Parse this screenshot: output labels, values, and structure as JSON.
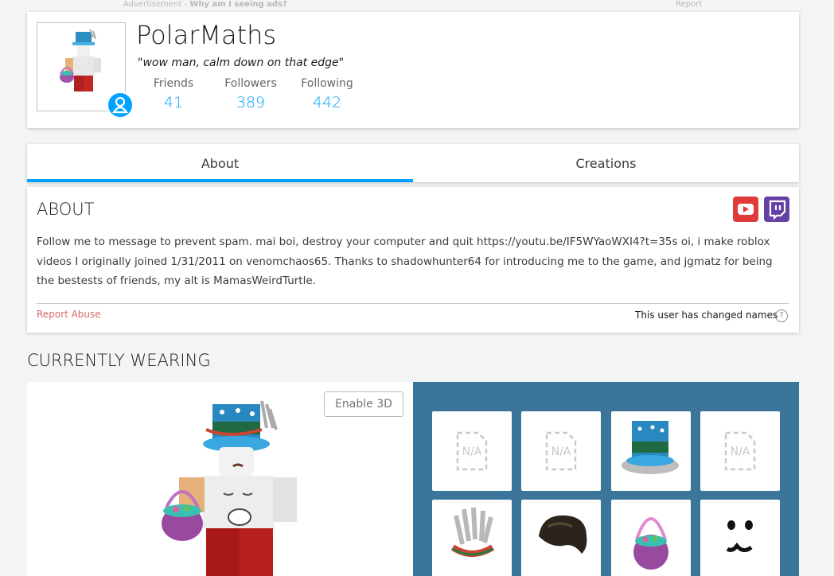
{
  "ads": {
    "label": "Advertisement - ",
    "why": "Why am I seeing ads?",
    "report": "Report"
  },
  "profile": {
    "username": "PolarMaths",
    "status": "\"wow man, calm down on that edge\"",
    "stats": [
      {
        "label": "Friends",
        "value": "41"
      },
      {
        "label": "Followers",
        "value": "389"
      },
      {
        "label": "Following",
        "value": "442"
      }
    ]
  },
  "tabs": [
    {
      "label": "About",
      "active": true
    },
    {
      "label": "Creations",
      "active": false
    }
  ],
  "about": {
    "heading": "ABOUT",
    "text": "Follow me to message to prevent spam. mai boi, destroy your computer and quit https://youtu.be/IF5WYaoWXI4?t=35s oi, i make roblox videos I originally joined 1/31/2011 on venomchaos65. Thanks to shadowhunter64 for introducing me to the game, and jgmatz for being the bestests of friends, my alt is MamasWeirdTurtle.",
    "report_abuse": "Report Abuse",
    "changed_names": "This user has changed names",
    "help": "?",
    "social": [
      "youtube-icon",
      "twitch-icon"
    ]
  },
  "wearing": {
    "heading": "CURRENTLY WEARING",
    "enable_3d": "Enable 3D",
    "items": [
      {
        "type": "na",
        "label": "N/A"
      },
      {
        "type": "na",
        "label": "N/A"
      },
      {
        "type": "top-hat"
      },
      {
        "type": "na",
        "label": "N/A"
      },
      {
        "type": "wings-hat"
      },
      {
        "type": "hair"
      },
      {
        "type": "basket"
      },
      {
        "type": "face"
      }
    ]
  },
  "colors": {
    "accent": "#00a2ff",
    "wear_bg": "#3b7599",
    "report": "#d86868"
  }
}
